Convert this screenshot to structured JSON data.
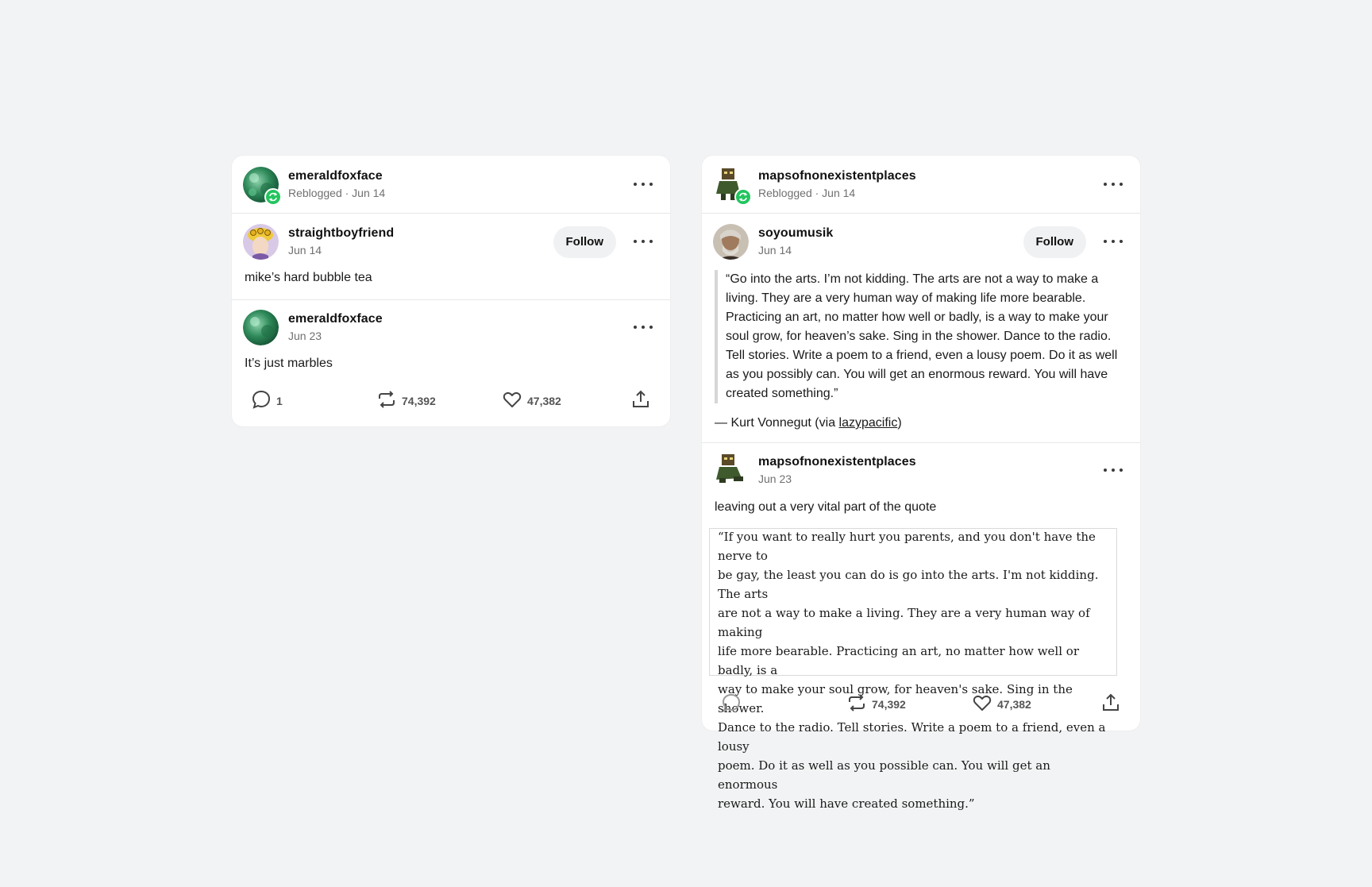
{
  "left_post": {
    "reblogger": {
      "name": "emeraldfoxface",
      "meta": "Reblogged · Jun 14"
    },
    "original": {
      "name": "straightboyfriend",
      "date": "Jun 14",
      "follow_label": "Follow",
      "text": "mike’s hard bubble tea"
    },
    "reply": {
      "name": "emeraldfoxface",
      "date": "Jun 23",
      "text": "It’s just marbles"
    },
    "actions": {
      "comments": "1",
      "reblogs": "74,392",
      "likes": "47,382"
    }
  },
  "right_post": {
    "reblogger": {
      "name": "mapsofnonexistentplaces",
      "meta": "Reblogged · Jun 14"
    },
    "original": {
      "name": "soyoumusik",
      "date": "Jun 14",
      "follow_label": "Follow",
      "quote_lines": [
        "“Go into the arts. I’m not kidding. The arts are not a way to make a",
        "living. They are a very human way of making life more bearable.",
        "Practicing an art, no matter how well or badly, is a way to make your",
        "soul grow, for heaven’s sake. Sing in the shower. Dance to the radio.",
        "Tell stories. Write a poem to a friend, even a lousy poem. Do it as well",
        "as you possibly can. You will get an enormous reward. You will have",
        "created something.”"
      ],
      "attribution_prefix": "— Kurt Vonnegut (via ",
      "attribution_link": "lazypacific",
      "attribution_suffix": ")"
    },
    "reply": {
      "name": "mapsofnonexistentplaces",
      "date": "Jun 23",
      "text": "leaving out a very vital part of the quote",
      "quote_lines": [
        "“If you want to really hurt you parents, and you don't have the nerve to",
        "be gay, the least you can do is go into the arts. I'm not kidding. The arts",
        "are not a way to make a living. They are a very human way of making",
        "life more bearable. Practicing an art, no matter how well or badly, is a",
        "way to make your soul grow, for heaven's sake. Sing in the shower.",
        "Dance to the radio. Tell stories. Write a poem to a friend, even a lousy",
        "poem. Do it as well as you possible can. You will get an enormous",
        "reward. You will have created something.”"
      ]
    },
    "actions": {
      "reblogs": "74,392",
      "likes": "47,382"
    }
  },
  "colors": {
    "reblog_badge": "#22c55e",
    "background": "#f2f3f4",
    "card": "#ffffff"
  }
}
